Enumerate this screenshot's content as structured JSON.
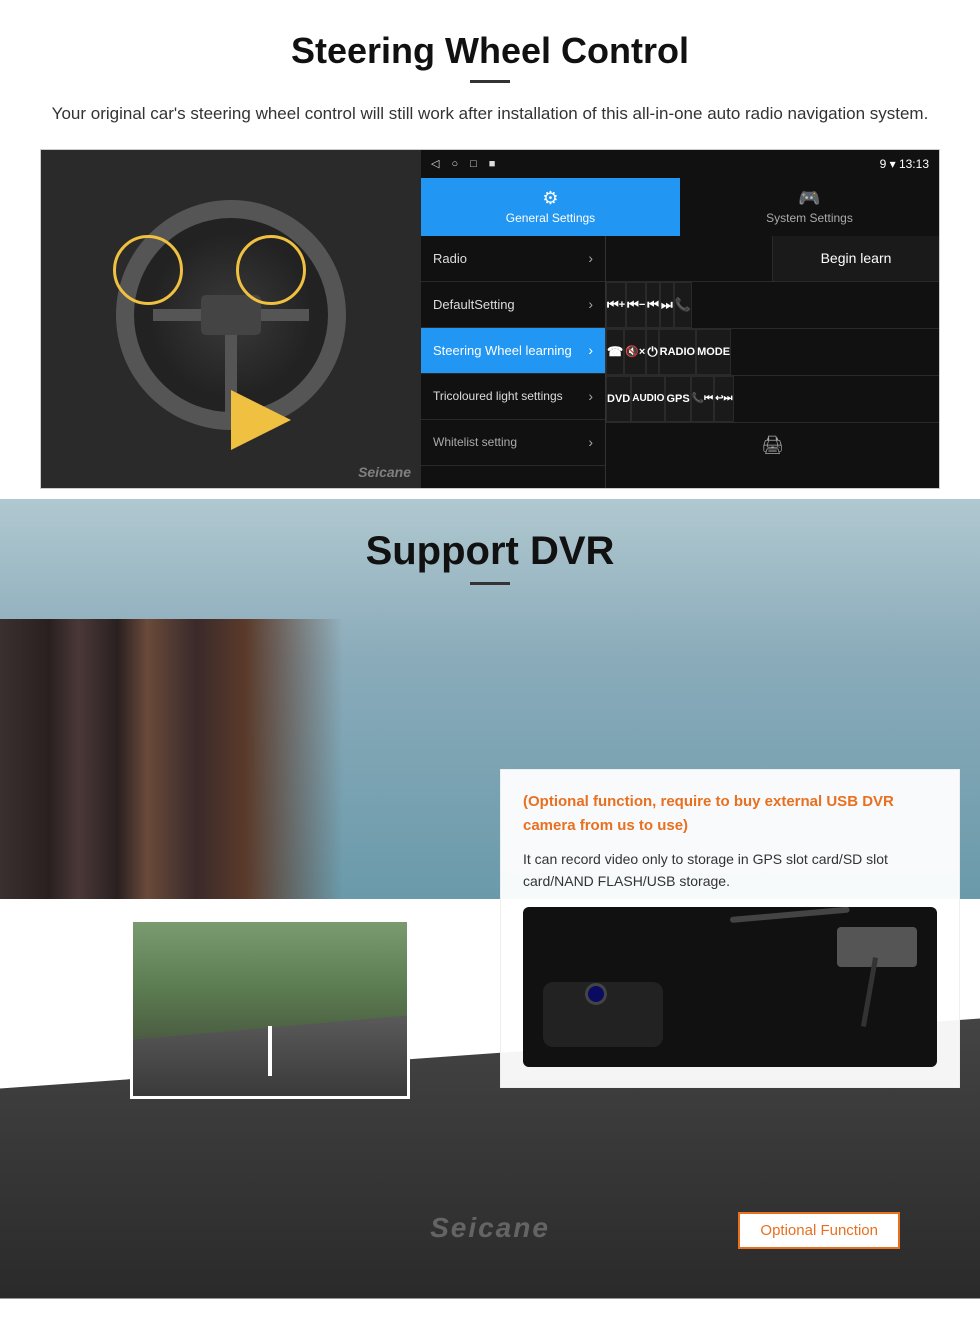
{
  "section1": {
    "title": "Steering Wheel Control",
    "description": "Your original car's steering wheel control will still work after installation of this all-in-one auto radio navigation system.",
    "statusbar": {
      "icons": [
        "◁",
        "○",
        "□",
        "■"
      ],
      "right": "9 ▾ 13:13"
    },
    "tabs": {
      "general": {
        "icon": "⚙",
        "label": "General Settings"
      },
      "system": {
        "icon": "🎮",
        "label": "System Settings"
      }
    },
    "menu": {
      "items": [
        {
          "label": "Radio",
          "active": false
        },
        {
          "label": "DefaultSetting",
          "active": false
        },
        {
          "label": "Steering Wheel learning",
          "active": true
        },
        {
          "label": "Tricoloured light settings",
          "active": false
        }
      ],
      "whitelist": "Whitelist setting"
    },
    "begin_learn": "Begin learn",
    "controls": {
      "row1": [
        "⏮+",
        "⏮-",
        "⏮",
        "⏭",
        "📞"
      ],
      "row2": [
        "☎",
        "🔇",
        "⏻",
        "RADIO",
        "MODE"
      ],
      "row3": [
        "DVD",
        "AUDIO",
        "GPS",
        "📞⏮",
        "↩⏭"
      ]
    }
  },
  "section2": {
    "title": "Support DVR",
    "optional_heading": "(Optional function, require to buy external USB DVR camera from us to use)",
    "description": "It can record video only to storage in GPS slot card/SD slot card/NAND FLASH/USB storage.",
    "optional_badge": "Optional Function",
    "watermark": "Seicane"
  }
}
